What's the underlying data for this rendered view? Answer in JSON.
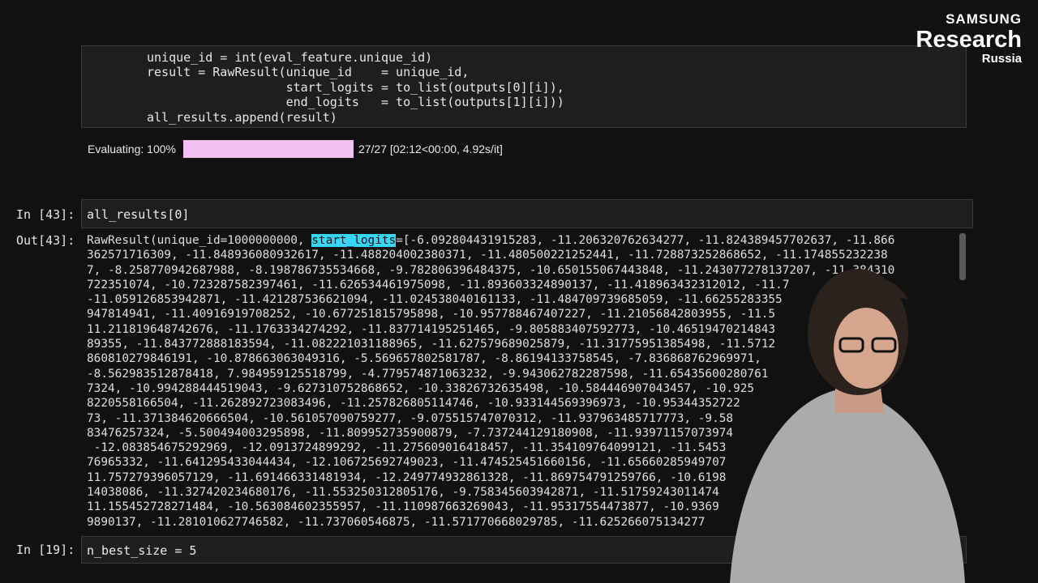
{
  "top_cell": {
    "lines": [
      "unique_id = int(eval_feature.unique_id)",
      "result = RawResult(unique_id    = unique_id,",
      "                   start_logits = to_list(outputs[0][i]),",
      "                   end_logits   = to_list(outputs[1][i]))",
      "all_results.append(result)"
    ]
  },
  "progress": {
    "label": "Evaluating: 100%",
    "fraction": 1.0,
    "meta": "27/27 [02:12<00:00, 4.92s/it]",
    "bar_color": "#f3bff3"
  },
  "cell43": {
    "in_prompt": "In [43]:",
    "code": "all_results[0]",
    "out_prompt": "Out[43]:",
    "out_prefix": "RawResult(unique_id=1000000000, ",
    "out_highlight": "start_logits",
    "out_rest_first": "=[-6.092804431915283, -11.206320762634277, -11.824389457702637, -11.866",
    "out_lines": [
      "362571716309, -11.848936080932617, -11.488204002380371, -11.480500221252441, -11.728873252868652, -11.174855232238",
      "7, -8.258770942687988, -8.198786735534668, -9.782806396484375, -10.650155067443848, -11.243077278137207, -11.384310",
      "722351074, -10.723287582397461, -11.626534461975098, -11.893603324890137, -11.418963432312012, -11.7",
      "-11.059126853942871, -11.421287536621094, -11.024538040161133, -11.484709739685059, -11.66255283355",
      "947814941, -11.40916919708252, -10.677251815795898, -10.957788467407227, -11.21056842803955, -11.5",
      "11.211819648742676, -11.1763334274292, -11.837714195251465, -9.805883407592773, -10.46519470214843",
      "89355, -11.843772888183594, -11.082221031188965, -11.627579689025879, -11.31775951385498, -11.5712",
      "860810279846191, -10.878663063049316, -5.569657802581787, -8.86194133758545, -7.836868762969971,",
      "-8.562983512878418, 7.984959125518799, -4.779574871063232, -9.943062782287598, -11.65435600280761",
      "7324, -10.994288444519043, -9.627310752868652, -10.33826732635498, -10.584446907043457, -10.925",
      "8220558166504, -11.262892723083496, -11.257826805114746, -10.933144569396973, -10.95344352722",
      "73, -11.371384620666504, -10.561057090759277, -9.075515747070312, -11.937963485717773, -9.58",
      "83476257324, -5.500494003295898, -11.809952735900879, -7.737244129180908, -11.93971157073974",
      " -12.083854675292969, -12.0913724899292, -11.275609016418457, -11.354109764099121, -11.5453",
      "76965332, -11.641295433044434, -12.106725692749023, -11.474525451660156, -11.65660285949707",
      "11.757279396057129, -11.691466331481934, -12.249774932861328, -11.869754791259766, -10.6198",
      "14038086, -11.327420234680176, -11.553250312805176, -9.758345603942871, -11.51759243011474",
      "11.155452728271484, -10.563084602355957, -11.110987663269043, -11.95317554473877, -10.9369",
      "9890137, -11.281010627746582, -11.737060546875, -11.571770668029785, -11.625266075134277"
    ]
  },
  "cell19": {
    "in_prompt": "In [19]:",
    "code": "n_best_size = 5"
  },
  "logo": {
    "line1": "SAMSUNG",
    "line2": "Research",
    "line3": "Russia"
  }
}
